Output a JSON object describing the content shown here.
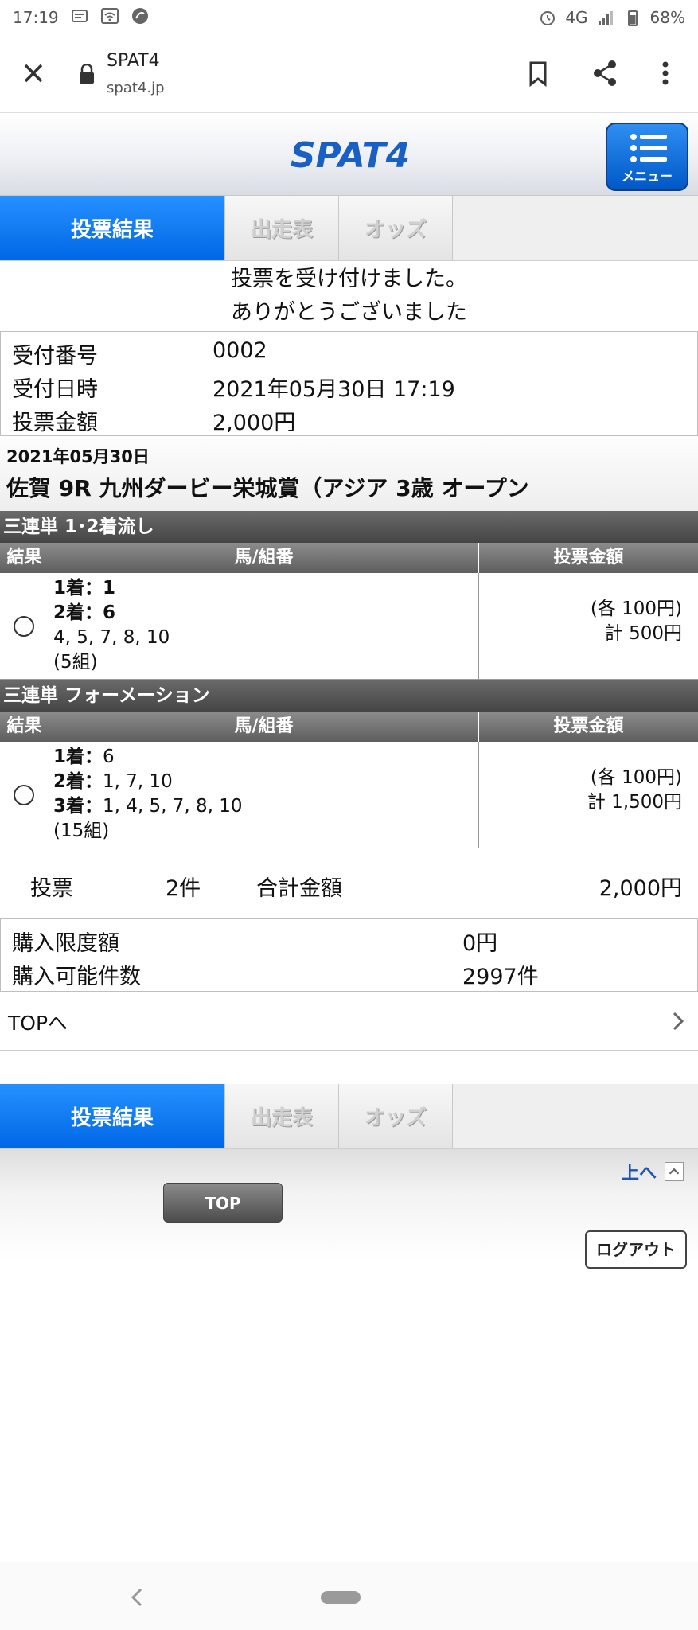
{
  "status_bar": {
    "time": "17:19",
    "network": "4G",
    "battery": "68%",
    "icons": [
      "news-icon",
      "wifi-hotspot-icon",
      "app-icon",
      "alarm-icon",
      "signal-icon",
      "battery-icon"
    ]
  },
  "browser": {
    "title": "SPAT4",
    "url": "spat4.jp"
  },
  "header": {
    "logo_text": "SPAT4",
    "menu_label": "メニュー",
    "accent_color": "#0067e5"
  },
  "tabs": [
    {
      "label": "投票結果",
      "active": true
    },
    {
      "label": "出走表",
      "active": false
    },
    {
      "label": "オッズ",
      "active": false
    }
  ],
  "message": {
    "line1": "投票を受け付けました。",
    "line2": "ありがとうございました"
  },
  "receipt": {
    "number_label": "受付番号",
    "number_value": "0002",
    "datetime_label": "受付日時",
    "datetime_value": "2021年05月30日 17:19",
    "amount_label": "投票金額",
    "amount_value": "2,000円"
  },
  "race": {
    "date": "2021年05月30日",
    "name": "佐賀  9R 九州ダービー栄城賞（アジア 3歳 オープン"
  },
  "bets": [
    {
      "title": "三連単 1･2着流し",
      "col_result": "結果",
      "col_combo": "馬/組番",
      "col_amount": "投票金額",
      "lines": [
        {
          "label": "1着：",
          "value": "1"
        },
        {
          "label": "2着：",
          "value": "6"
        }
      ],
      "extra": "4, 5, 7, 8, 10",
      "count": "(5組)",
      "each": "(各 100円)",
      "total": "計 500円"
    },
    {
      "title": "三連単 フォーメーション",
      "col_result": "結果",
      "col_combo": "馬/組番",
      "col_amount": "投票金額",
      "lines": [
        {
          "label": "1着：",
          "value": "6"
        },
        {
          "label": "2着：",
          "value": "1, 7, 10"
        },
        {
          "label": "3着：",
          "value": "1, 4, 5, 7, 8, 10"
        }
      ],
      "count": "(15組)",
      "each": "(各 100円)",
      "total": "計 1,500円"
    }
  ],
  "summary": {
    "vote_label": "投票",
    "vote_count": "2件",
    "total_label": "合計金額",
    "total_value": "2,000円"
  },
  "limits": {
    "limit_label": "購入限度額",
    "limit_value": "0円",
    "possible_label": "購入可能件数",
    "possible_value": "2997件"
  },
  "top_link": "TOPへ",
  "footer": {
    "to_top": "上へ",
    "top_button": "TOP",
    "logout_button": "ログアウト"
  }
}
